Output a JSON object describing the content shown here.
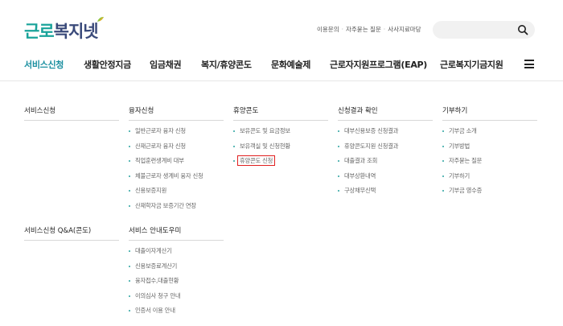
{
  "header": {
    "logo_part1": "근로",
    "logo_part2": "복지넷",
    "top_links": [
      "이용문의",
      "자주묻는 질문",
      "사사지료마당"
    ],
    "search_placeholder": ""
  },
  "gnb": {
    "items": [
      "서비스신청",
      "생활안정지금",
      "임금채권",
      "복지/휴양콘도",
      "문화예술제",
      "근로자지원프로그램(EAP)",
      "근로복지기금지원"
    ],
    "active_index": 0
  },
  "menu": {
    "columns": [
      {
        "head": "서비스신청",
        "items": []
      },
      {
        "head": "융자신청",
        "items": [
          "일반근로자 융자 신청",
          "산재근로자 융자 신청",
          "직업훈련생계비 대부",
          "체불근로자 생계비 융자 신청",
          "신용보증지원",
          "산재학자금 보증기간 연장"
        ]
      },
      {
        "head": "휴양콘도",
        "items": [
          "보유콘도 및 요금정보",
          "보유객실 및 신청현황",
          "휴양콘도 신청"
        ],
        "highlight_index": 2
      },
      {
        "head": "신청결과 확인",
        "items": [
          "대부신용보증 신청결과",
          "휴양콘도지원 신청결과",
          "대출결과 조회",
          "대부상환내역",
          "구상채무신택"
        ]
      },
      {
        "head": "기부하기",
        "items": [
          "기부금 소개",
          "기부방법",
          "자주묻는 질문",
          "기부하기",
          "기부금 영수증"
        ]
      }
    ],
    "columns_row2": [
      {
        "head": "서비스신청 Q&A(콘도)",
        "items": []
      },
      {
        "head": "서비스 안내도우미",
        "items": [
          "대출이자계산기",
          "신용보증료계산기",
          "융자접수,대출현황",
          "이의심사 청구 안내",
          "인증서 이용 안내"
        ]
      }
    ]
  },
  "colors": {
    "brand_teal": "#1aa39a",
    "brand_navy": "#3a4a7a",
    "highlight_red": "#e02020"
  },
  "icons": {
    "search": "search-icon",
    "menu": "hamburger-menu-icon"
  }
}
